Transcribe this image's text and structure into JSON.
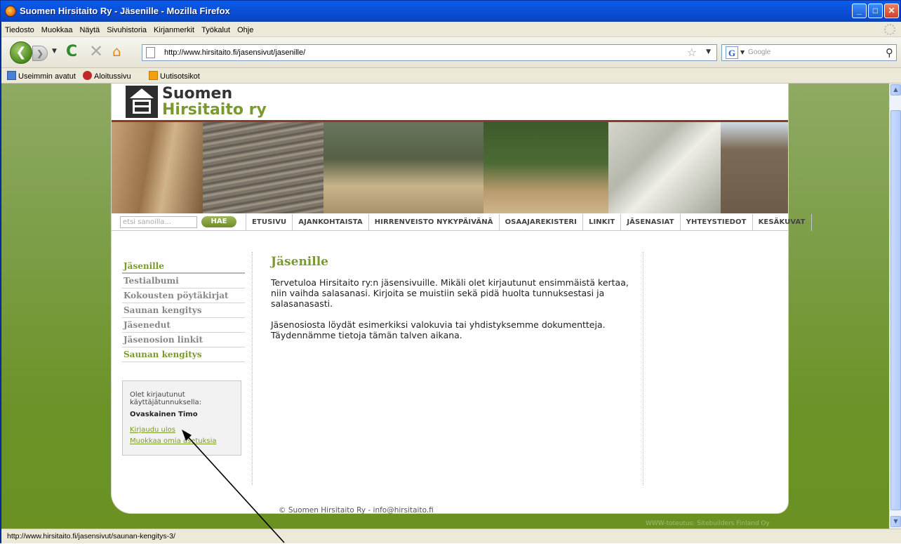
{
  "window": {
    "title": "Suomen Hirsitaito Ry - Jäsenille - Mozilla Firefox",
    "min_label": "_",
    "max_label": "□",
    "close_label": "✕"
  },
  "menubar": {
    "items": [
      "Tiedosto",
      "Muokkaa",
      "Näytä",
      "Sivuhistoria",
      "Kirjanmerkit",
      "Työkalut",
      "Ohje"
    ]
  },
  "navbar": {
    "back_glyph": "❮",
    "forward_glyph": "❯",
    "dropdown_glyph": "▼",
    "reload_glyph": "C",
    "stop_glyph": "✕",
    "home_glyph": "⌂",
    "url": "http://www.hirsitaito.fi/jasensivut/jasenille/",
    "star_glyph": "☆",
    "search_engine_glyph": "G",
    "search_placeholder": "Google",
    "search_glyph": "⚲"
  },
  "bookmarks": [
    {
      "label": "Useimmin avatut",
      "color": "#4a7fd8"
    },
    {
      "label": "Aloitussivu",
      "color": "#c0282a"
    },
    {
      "label": "Uutisotsikot",
      "color": "#f1a10e"
    }
  ],
  "site": {
    "logo_line1": "Suomen",
    "logo_line2": "Hirsitaito ry",
    "search_placeholder": "etsi sanoilla...",
    "search_button": "HAE",
    "menu": [
      "ETUSIVU",
      "AJANKOHTAISTA",
      "HIRRENVEISTO NYKYPÄIVÄNÄ",
      "OSAAJAREKISTERI",
      "LINKIT",
      "JÄSENASIAT",
      "YHTEYSTIEDOT",
      "KESÄKUVAT"
    ],
    "sidebar": [
      {
        "label": "Jäsenille",
        "state": "active"
      },
      {
        "label": "Testialbumi",
        "state": "normal"
      },
      {
        "label": "Kokousten pöytäkirjat",
        "state": "normal"
      },
      {
        "label": "Saunan kengitys",
        "state": "normal"
      },
      {
        "label": "Jäsenedut",
        "state": "normal"
      },
      {
        "label": "Jäsenosion linkit",
        "state": "normal"
      },
      {
        "label": "Saunan kengitys",
        "state": "hover"
      }
    ],
    "login": {
      "text": "Olet kirjautunut käyttäjätunnuksella:",
      "user": "Ovaskainen Timo",
      "logout": "Kirjaudu ulos",
      "edit": "Muokkaa omia asetuksia"
    },
    "heading": "Jäsenille",
    "paragraphs": [
      "Tervetuloa Hirsitaito ry:n jäsensivuille. Mikäli olet kirjautunut ensimmäistä kertaa, niin vaihda salasanasi. Kirjoita se muistiin sekä  pidä huolta tunnuksestasi ja salasanasasti.",
      "Jäsenosiosta löydät esimerkiksi valokuvia tai yhdistyksemme dokumentteja. Täydennämme tietoja tämän talven aikana."
    ],
    "footer": "© Suomen Hirsitaito Ry - info@hirsitaito.fi",
    "credit": "WWW-toteutus: Sitebuilders Finland Oy"
  },
  "statusbar": {
    "text": "http://www.hirsitaito.fi/jasensivut/saunan-kengitys-3/"
  },
  "colors": {
    "accent_green": "#7a9a2e",
    "title_blue": "#0a5ae8",
    "stripe_red": "#8b3a2a"
  },
  "icons": [
    "firefox-icon",
    "back-arrow-icon",
    "forward-arrow-icon",
    "reload-icon",
    "stop-icon",
    "home-icon",
    "page-icon",
    "bookmark-star-icon",
    "google-icon",
    "magnifier-icon",
    "throbber-icon",
    "house-logo-icon"
  ]
}
